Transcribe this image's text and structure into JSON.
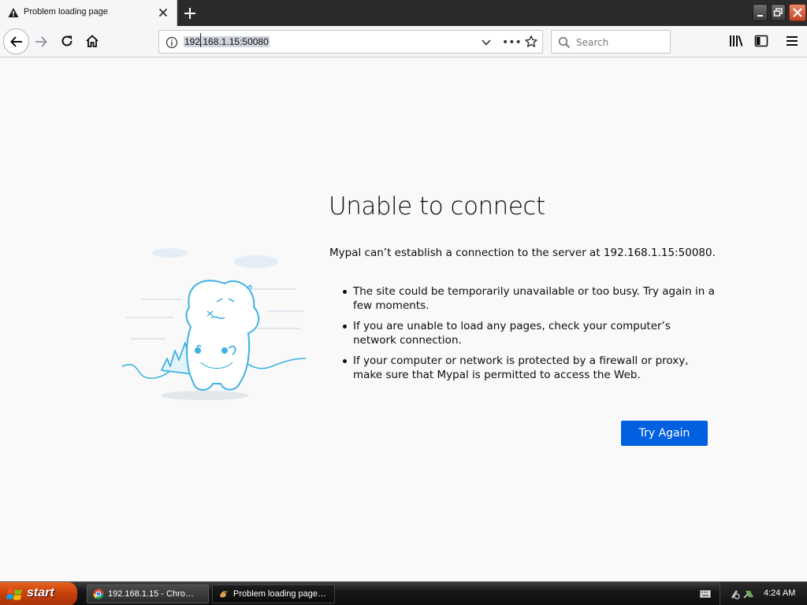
{
  "tab": {
    "title": "Problem loading page",
    "icon": "warning-icon"
  },
  "window_controls": {
    "icons": [
      "minimize-icon",
      "restore-icon",
      "close-icon"
    ]
  },
  "navbar": {
    "url": "192.168.1.15:50080",
    "search_placeholder": "Search",
    "icons": [
      "back-arrow-icon",
      "forward-arrow-icon",
      "reload-icon",
      "home-icon",
      "info-icon",
      "chevron-down-icon",
      "more-dots-icon",
      "bookmark-star-icon",
      "search-icon",
      "library-icon",
      "sidebar-icon",
      "hamburger-menu-icon"
    ],
    "dots": "•••"
  },
  "error": {
    "title": "Unable to connect",
    "description": "Mypal can’t establish a connection to the server at 192.168.1.15:50080.",
    "items": [
      "The site could be temporarily unavailable or too busy. Try again in a few moments.",
      "If you are unable to load any pages, check your computer’s network connection.",
      "If your computer or network is protected by a firewall or proxy, make sure that Mypal is permitted to access the Web."
    ],
    "button": "Try Again",
    "accent": "#0060df"
  },
  "taskbar": {
    "start_label": "start",
    "tasks": [
      {
        "label": "192.168.1.15 - Chro…",
        "icon": "chrome-icon"
      },
      {
        "label": "Problem loading page…",
        "icon": "mypal-icon"
      }
    ],
    "clock": "4:24 AM"
  }
}
